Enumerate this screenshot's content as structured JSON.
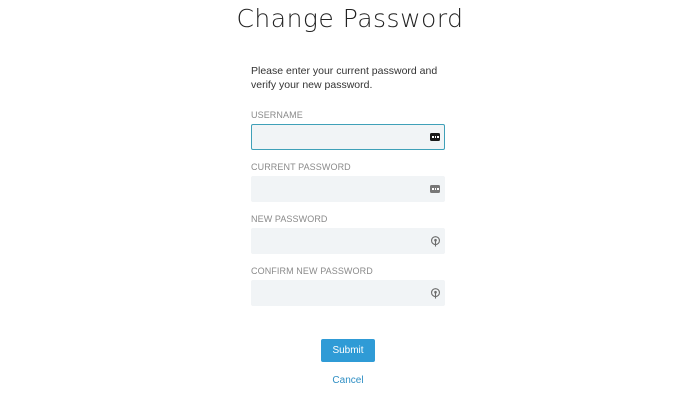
{
  "page": {
    "title": "Change Password",
    "intro": "Please enter your current password and verify your new password."
  },
  "form": {
    "username": {
      "label": "USERNAME",
      "value": "",
      "icon": "keyboard-icon",
      "focused": true
    },
    "current_password": {
      "label": "CURRENT PASSWORD",
      "value": "",
      "icon": "keyboard-icon"
    },
    "new_password": {
      "label": "NEW PASSWORD",
      "value": "",
      "icon": "key-icon"
    },
    "confirm_password": {
      "label": "CONFIRM NEW PASSWORD",
      "value": "",
      "icon": "key-icon"
    }
  },
  "actions": {
    "submit_label": "Submit",
    "cancel_label": "Cancel"
  },
  "colors": {
    "accent": "#2f9bd6",
    "focus_border": "#3fa0b8",
    "field_background": "#f1f4f6",
    "label_text": "#8a8a8a"
  }
}
